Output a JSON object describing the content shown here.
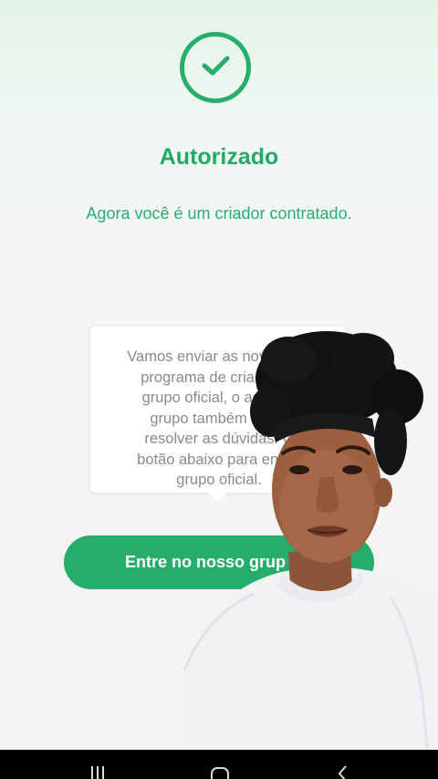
{
  "status": {
    "title": "Autorizado",
    "subtitle": "Agora você é um criador contratado."
  },
  "tooltip": {
    "lines": [
      "Vamos enviar as novidades",
      "programa de criador no",
      "grupo oficial, o adminis",
      "grupo também ajuda",
      "resolver as dúvidas. C",
      "botão abaixo para entrar",
      "grupo oficial."
    ]
  },
  "cta": {
    "label": "Entre no nosso grup"
  },
  "colors": {
    "brand_green": "#26ad6c",
    "tooltip_text": "#8a8a8a"
  },
  "icons": {
    "status": "check-circle-icon",
    "nav_recent": "recent-apps-icon",
    "nav_home": "home-icon",
    "nav_back": "back-icon"
  }
}
